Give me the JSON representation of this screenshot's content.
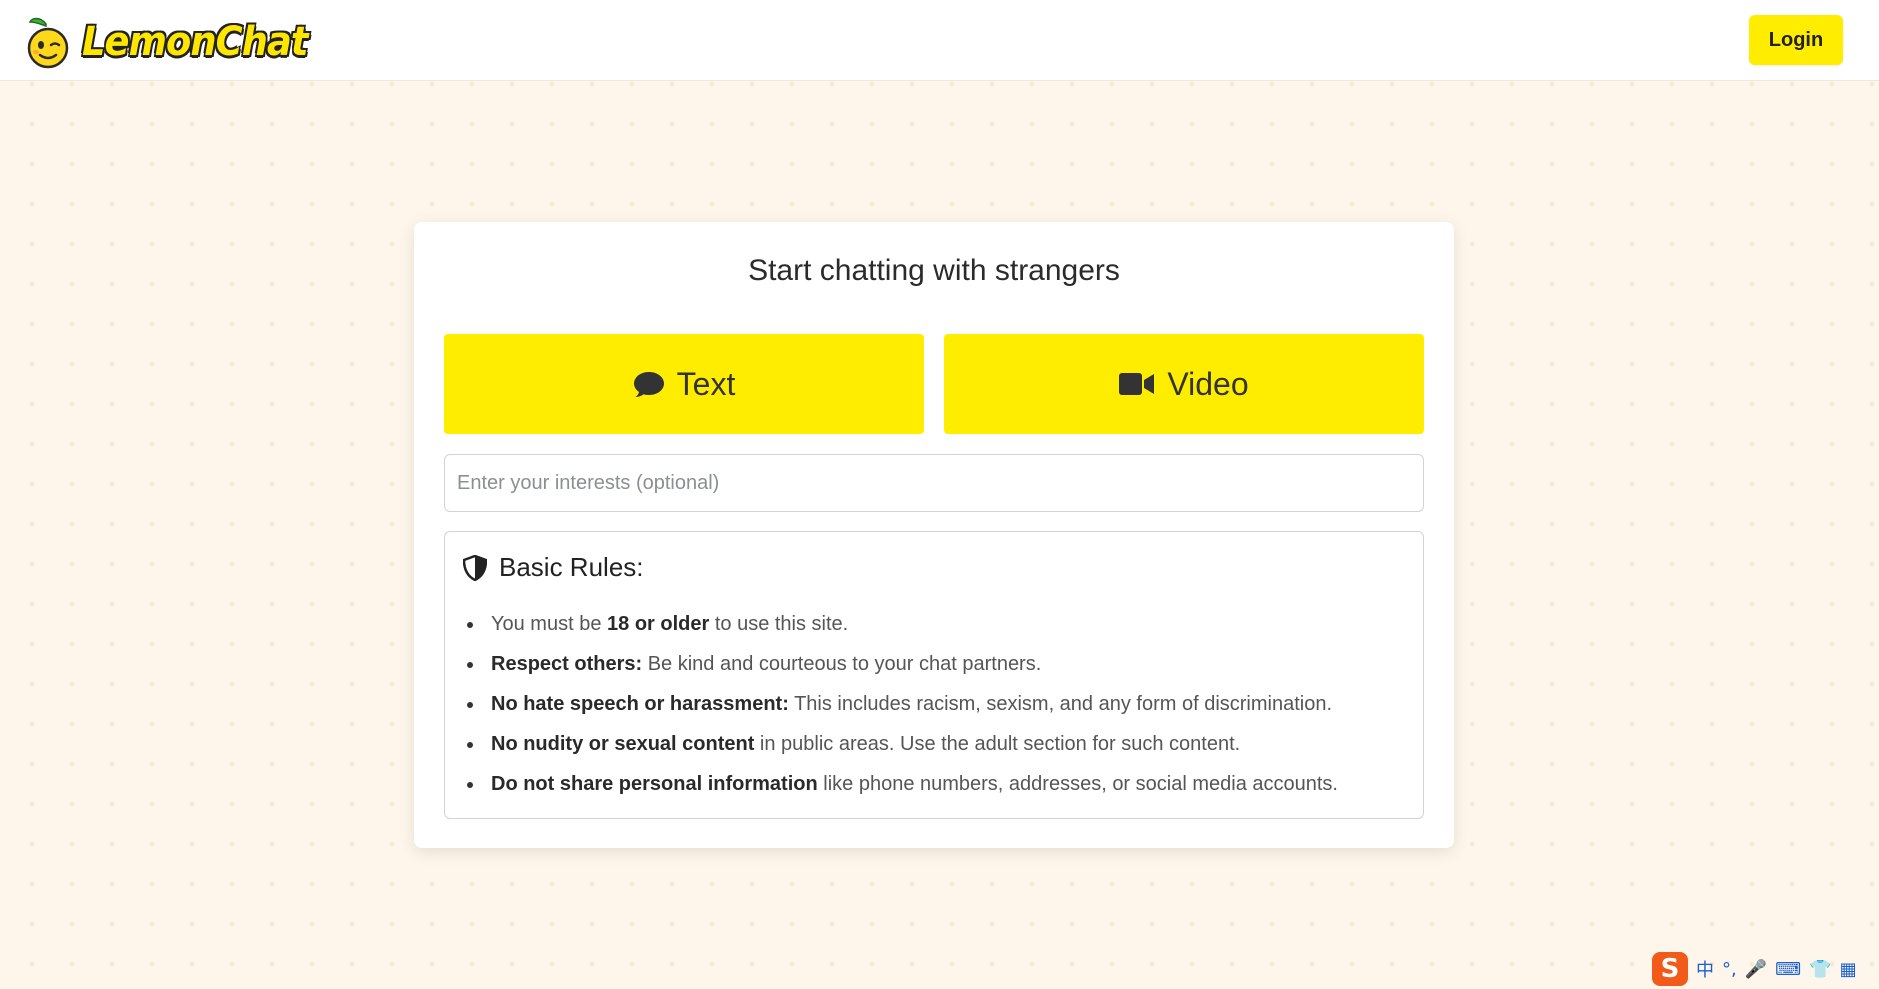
{
  "header": {
    "brand": "LemonChat",
    "login_label": "Login"
  },
  "card": {
    "title": "Start chatting with strangers",
    "text_button_label": "Text",
    "video_button_label": "Video",
    "interests_placeholder": "Enter your interests (optional)"
  },
  "rules": {
    "heading": "Basic Rules:",
    "items": [
      {
        "pre": "You must be ",
        "bold": "18 or older",
        "post": " to use this site."
      },
      {
        "pre": "",
        "bold": "Respect others:",
        "post": " Be kind and courteous to your chat partners."
      },
      {
        "pre": "",
        "bold": "No hate speech or harassment:",
        "post": " This includes racism, sexism, and any form of discrimination."
      },
      {
        "pre": "",
        "bold": "No nudity or sexual content",
        "post": " in public areas. Use the adult section for such content."
      },
      {
        "pre": "",
        "bold": "Do not share personal information",
        "post": " like phone numbers, addresses, or social media accounts."
      }
    ]
  },
  "ime": {
    "logo": "S",
    "items": [
      "中",
      "°,",
      "🎤",
      "⌨",
      "👕",
      "▦"
    ]
  },
  "colors": {
    "accent": "#ffed00",
    "background": "#fef6ea"
  },
  "icons": {
    "brand": "lemon-mascot-icon",
    "text": "comment-icon",
    "video": "video-camera-icon",
    "rules": "shield-icon"
  }
}
